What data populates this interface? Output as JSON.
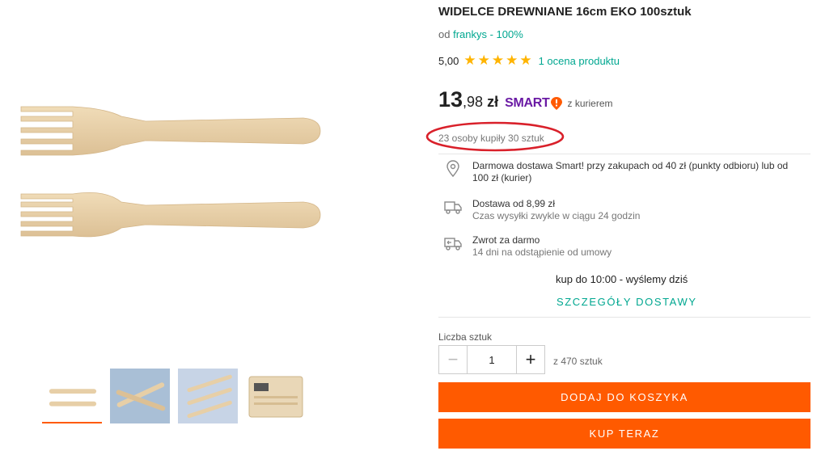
{
  "product": {
    "title": "WIDELCE DREWNIANE 16cm EKO 100sztuk",
    "seller_prefix": "od",
    "seller_link": "frankys - 100%",
    "rating_value": "5,00",
    "rating_stars": 5,
    "rating_count_link": "1 ocena produktu",
    "price_int": "13",
    "price_frac": ",98",
    "currency": "zł",
    "smart_label": "SMART",
    "courier_label": "z kurierem",
    "bought_info": "23 osoby kupiły 30 sztuk"
  },
  "delivery": {
    "free_delivery_text": "Darmowa dostawa Smart! przy zakupach od 40 zł (punkty odbioru) lub od 100 zł (kurier)",
    "shipping_title": "Dostawa od 8,99 zł",
    "shipping_sub": "Czas wysyłki zwykle w ciągu 24 godzin",
    "returns_title": "Zwrot za darmo",
    "returns_sub": "14 dni na odstąpienie od umowy",
    "cutoff_text": "kup do 10:00 - wyślemy dziś",
    "details_link": "SZCZEGÓŁY DOSTAWY"
  },
  "purchase": {
    "qty_label": "Liczba sztuk",
    "qty_value": "1",
    "qty_minus": "−",
    "qty_plus": "+",
    "stock_text": "z 470 sztuk",
    "add_to_cart": "DODAJ DO KOSZYKA",
    "buy_now": "KUP TERAZ"
  },
  "gallery": {
    "selected_thumbnail": 1,
    "thumbnail_count": 4
  },
  "colors": {
    "accent": "#ff5a00",
    "link": "#00a790",
    "smart_purple": "#6a1aa4",
    "star": "#ffb400",
    "highlight_circle": "#d9202a"
  }
}
